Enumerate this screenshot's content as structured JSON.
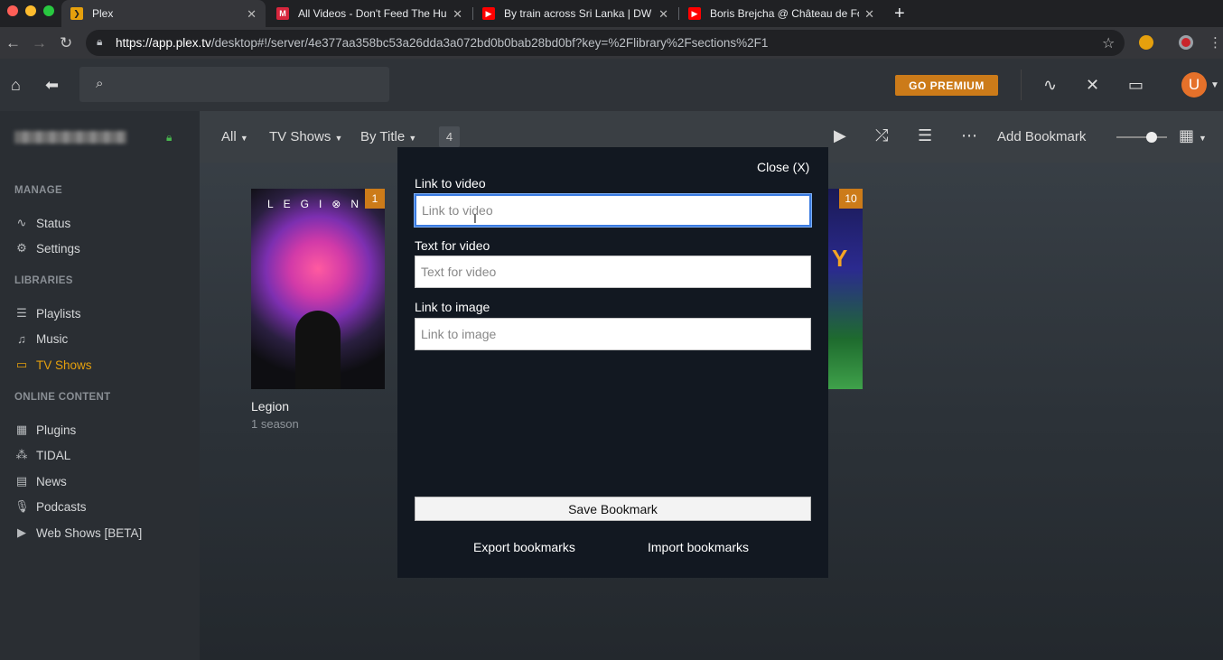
{
  "browser": {
    "tabs": [
      {
        "title": "Plex",
        "favicon": "plex-icon",
        "active": true
      },
      {
        "title": "All Videos - Don't Feed The Hu",
        "favicon": "dftv-icon",
        "active": false
      },
      {
        "title": "By train across Sri Lanka | DW",
        "favicon": "youtube-icon",
        "active": false
      },
      {
        "title": "Boris Brejcha @ Château de Fo",
        "favicon": "youtube-icon",
        "active": false
      }
    ],
    "url_host": "https://app.plex.tv",
    "url_path": "/desktop#!/server/4e377aa358bc53a26dda3a072bd0b0bab28bd0bf?key=%2Flibrary%2Fsections%2F1"
  },
  "header": {
    "premium_label": "GO PREMIUM",
    "avatar_letter": "U"
  },
  "sidebar": {
    "manage_heading": "MANAGE",
    "manage_items": [
      {
        "label": "Status",
        "icon": "activity-icon"
      },
      {
        "label": "Settings",
        "icon": "gear-icon"
      }
    ],
    "libraries_heading": "LIBRARIES",
    "library_items": [
      {
        "label": "Playlists",
        "icon": "list-icon"
      },
      {
        "label": "Music",
        "icon": "music-note-icon"
      },
      {
        "label": "TV Shows",
        "icon": "monitor-icon",
        "active": true
      }
    ],
    "online_heading": "ONLINE CONTENT",
    "online_items": [
      {
        "label": "Plugins",
        "icon": "grid-icon"
      },
      {
        "label": "TIDAL",
        "icon": "tidal-icon"
      },
      {
        "label": "News",
        "icon": "newspaper-icon"
      },
      {
        "label": "Podcasts",
        "icon": "microphone-icon"
      },
      {
        "label": "Web Shows [BETA]",
        "icon": "play-square-icon"
      }
    ]
  },
  "toolbar": {
    "filter_all": "All",
    "filter_type": "TV Shows",
    "sort": "By Title",
    "count": "4",
    "add_bookmark": "Add Bookmark"
  },
  "library": {
    "items": [
      {
        "title": "Legion",
        "subtitle": "1 season",
        "badge": "1",
        "poster_word": "LEGI⊗N"
      },
      {
        "badge": "10",
        "poster_letter": "Y"
      }
    ]
  },
  "modal": {
    "close_label": "Close (X)",
    "video_link_label": "Link to video",
    "video_link_placeholder": "Link to video",
    "video_text_label": "Text for video",
    "video_text_placeholder": "Text for video",
    "image_link_label": "Link to image",
    "image_link_placeholder": "Link to image",
    "save_label": "Save Bookmark",
    "export_label": "Export bookmarks",
    "import_label": "Import bookmarks"
  },
  "colors": {
    "accent": "#e5a00d",
    "premium": "#cc7b19",
    "modal_bg": "#121821"
  }
}
